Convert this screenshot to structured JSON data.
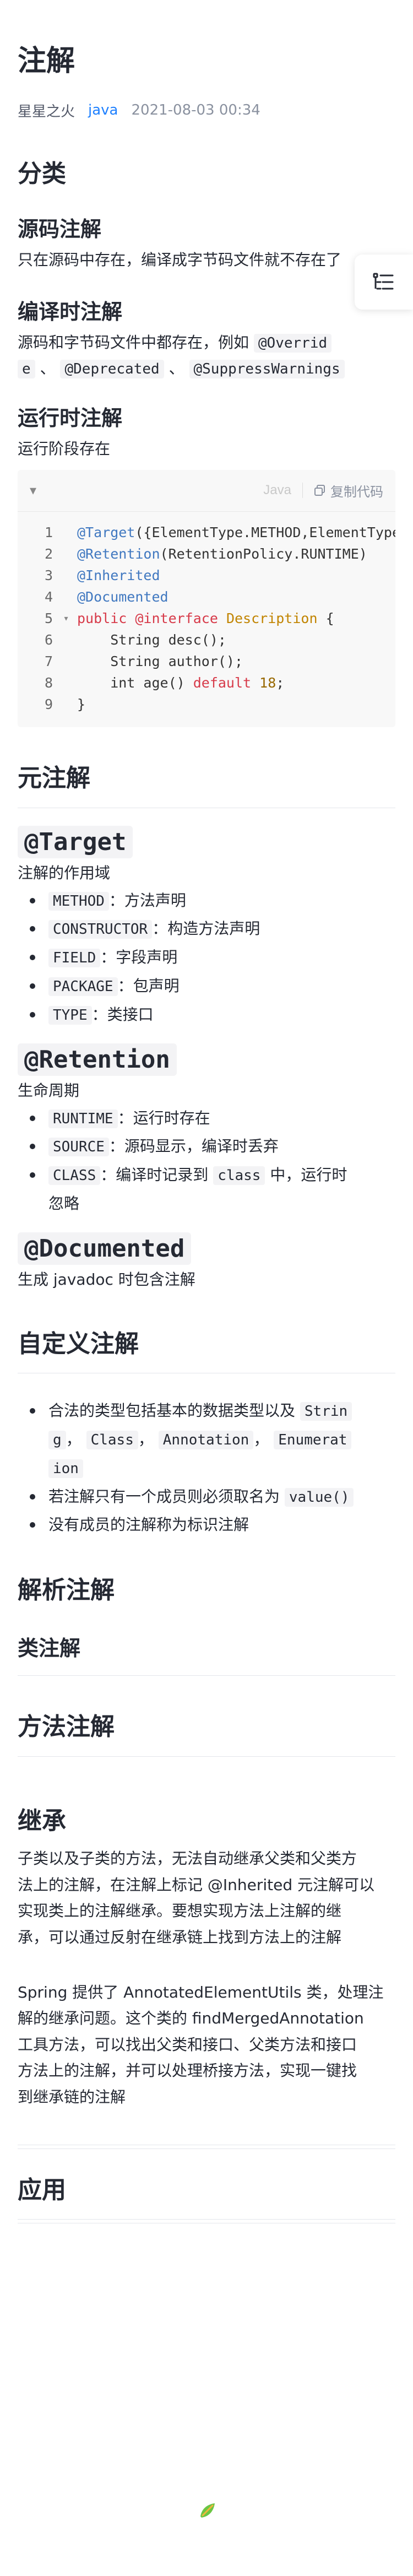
{
  "article": {
    "title": "注解",
    "author": "星星之火",
    "tag": "java",
    "date": "2021-08-03 00:34"
  },
  "sections": {
    "fenlei": "分类",
    "source": {
      "heading": "源码注解",
      "text": "只在源码中存在，编译成字节码文件就不存在了"
    },
    "compile": {
      "heading": "编译时注解",
      "text_pre": "源码和字节码文件中都存在，例如 ",
      "code1": "@Overrid",
      "code1b": "e",
      "sep1": "、",
      "code2": "@Deprecated",
      "sep2": "、",
      "code3": "@SuppressWarnings"
    },
    "runtime": {
      "heading": "运行时注解",
      "text": "运行阶段存在"
    },
    "meta": "元注解",
    "target": {
      "heading": "@Target",
      "desc": "注解的作用域",
      "items": [
        {
          "code": "METHOD",
          "text": "：方法声明"
        },
        {
          "code": "CONSTRUCTOR",
          "text": "：构造方法声明"
        },
        {
          "code": "FIELD",
          "text": "：字段声明"
        },
        {
          "code": "PACKAGE",
          "text": "：包声明"
        },
        {
          "code": "TYPE",
          "text": "：类接口"
        }
      ]
    },
    "retention": {
      "heading": "@Retention",
      "desc": "生命周期",
      "items": [
        {
          "code": "RUNTIME",
          "text": "：运行时存在"
        },
        {
          "code": "SOURCE",
          "text": "：源码显示，编译时丢弃"
        }
      ],
      "class_item": {
        "code": "CLASS",
        "text_a": "：编译时记录到 ",
        "code2": "class",
        "text_b": " 中，运行时",
        "text_c": "忽略"
      }
    },
    "documented": {
      "heading": "@Documented",
      "desc": "生成 javadoc 时包含注解"
    },
    "custom": {
      "heading": "自定义注解",
      "item1_pre": "合法的类型包括基本的数据类型以及 ",
      "item1_code1": "Strin",
      "item1_code1b": "g",
      "item1_sep1": "，",
      "item1_code2": "Class",
      "item1_sep2": "，",
      "item1_code3": "Annotation",
      "item1_sep3": "，",
      "item1_code4": "Enumerat",
      "item1_code4b": "ion",
      "item2_pre": "若注解只有一个成员则必须取名为 ",
      "item2_code": "value()",
      "item3": "没有成员的注解称为标识注解"
    },
    "parse": "解析注解",
    "class_ann": "类注解",
    "method_ann": "方法注解",
    "inherit": {
      "heading": "继承",
      "p1": [
        "子类以及子类的方法，无法自动继承父类和父类方",
        "法上的注解，在注解上标记 @Inherited 元注解可以",
        "实现类上的注解继承。要想实现方法上注解的继",
        "承，可以通过反射在继承链上找到方法上的注解"
      ],
      "p2": [
        "Spring 提供了 AnnotatedElementUtils 类，处理注",
        "解的继承问题。这个类的 findMergedAnnotation",
        "工具方法，可以找出父类和接口、父类方法和接口",
        "方法上的注解，并可以处理桥接方法，实现一键找",
        "到继承链的注解"
      ]
    },
    "apply": "应用"
  },
  "code_block": {
    "language": "Java",
    "copy_label": "复制代码",
    "lines": [
      {
        "n": "1",
        "parts": [
          [
            "ann",
            "@Target"
          ],
          [
            "txt",
            "({ElementType.METHOD,ElementType.TYPE})"
          ]
        ]
      },
      {
        "n": "2",
        "parts": [
          [
            "ann",
            "@Retention"
          ],
          [
            "txt",
            "(RetentionPolicy.RUNTIME)"
          ]
        ]
      },
      {
        "n": "3",
        "parts": [
          [
            "ann",
            "@Inherited"
          ]
        ]
      },
      {
        "n": "4",
        "parts": [
          [
            "ann",
            "@Documented"
          ]
        ]
      },
      {
        "n": "5",
        "fold": true,
        "parts": [
          [
            "kw2",
            "public "
          ],
          [
            "kw2",
            "@interface "
          ],
          [
            "cls",
            "Description"
          ],
          [
            "txt",
            " {"
          ]
        ]
      },
      {
        "n": "6",
        "parts": [
          [
            "txt",
            "    String desc();"
          ]
        ]
      },
      {
        "n": "7",
        "parts": [
          [
            "txt",
            "    String author();"
          ]
        ]
      },
      {
        "n": "8",
        "parts": [
          [
            "txt",
            "    int age() "
          ],
          [
            "kw2",
            "default "
          ],
          [
            "num",
            "18"
          ],
          [
            "txt",
            ";"
          ]
        ]
      },
      {
        "n": "9",
        "parts": [
          [
            "txt",
            "}"
          ]
        ]
      }
    ]
  },
  "icons": {
    "toc": "list-toc-icon",
    "collapse": "caret-down-icon",
    "copy": "copy-icon",
    "footer": "leaf-logo-icon"
  }
}
